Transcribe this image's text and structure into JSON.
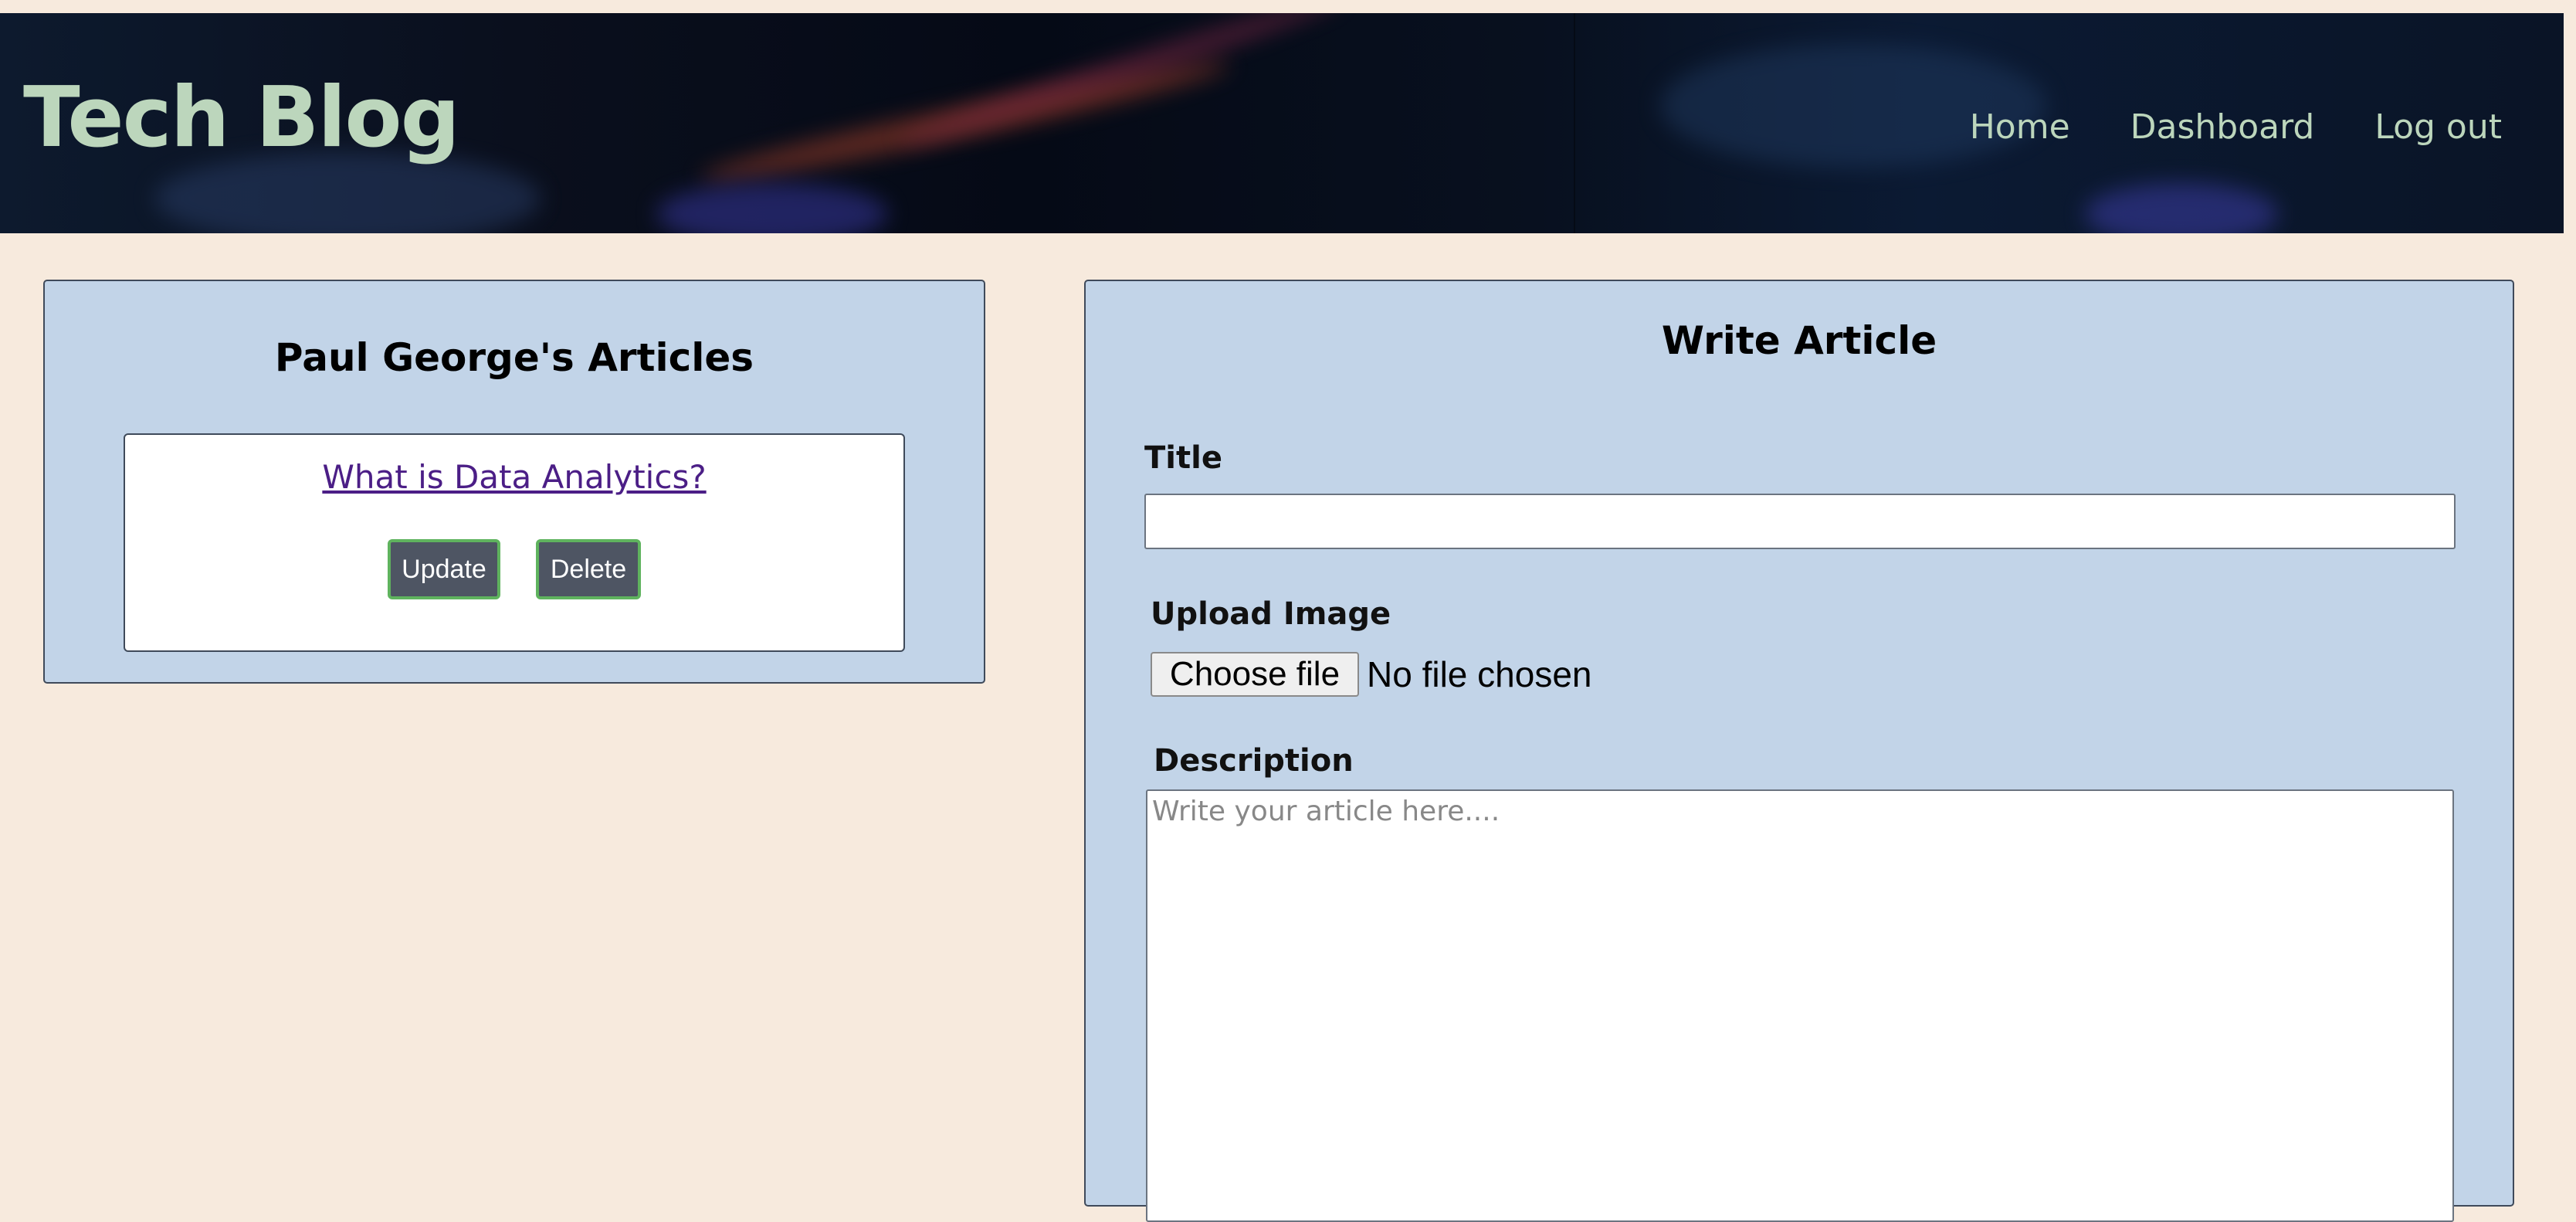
{
  "header": {
    "logo": "Tech Blog",
    "nav": [
      "Home",
      "Dashboard",
      "Log out"
    ]
  },
  "articles_panel": {
    "title": "Paul George's Articles",
    "articles": [
      {
        "title": "What is Data Analytics?",
        "update_label": "Update",
        "delete_label": "Delete"
      }
    ]
  },
  "write_panel": {
    "title": "Write Article",
    "title_label": "Title",
    "title_value": "",
    "upload_label": "Upload Image",
    "choose_file_label": "Choose file",
    "file_status": "No file chosen",
    "description_label": "Description",
    "description_placeholder": "Write your article here...."
  },
  "colors": {
    "background": "#f7eadd",
    "panel": "#c2d4e8",
    "header_text": "#bcd6bc",
    "link": "#4b1e86",
    "button": "#4e5563",
    "button_border": "#5fb35e"
  }
}
